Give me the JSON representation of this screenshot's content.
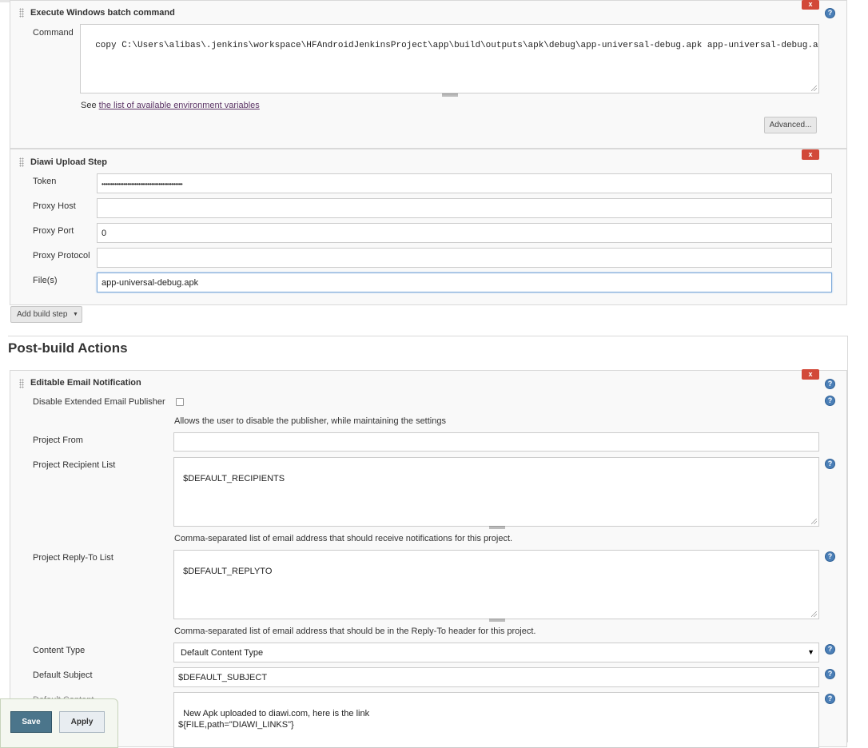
{
  "colors": {
    "delete": "#d24939",
    "help": "#4b7fb7",
    "save": "#4b758b"
  },
  "batch_step": {
    "title": "Execute Windows batch command",
    "delete_label": "x",
    "help_label": "?",
    "command_label": "Command",
    "command_value": "copy C:\\Users\\alibas\\.jenkins\\workspace\\HFAndroidJenkinsProject\\app\\build\\outputs\\apk\\debug\\app-universal-debug.apk app-universal-debug.apk",
    "see_prefix": "See",
    "env_link": "the list of available environment variables",
    "advanced_label": "Advanced..."
  },
  "diawi_step": {
    "title": "Diawi Upload Step",
    "delete_label": "x",
    "token_label": "Token",
    "token_value": "••••••••••••••••••••••••••••••••••••••••••••",
    "proxy_host_label": "Proxy Host",
    "proxy_host_value": "",
    "proxy_port_label": "Proxy Port",
    "proxy_port_value": "0",
    "proxy_protocol_label": "Proxy Protocol",
    "proxy_protocol_value": "",
    "files_label": "File(s)",
    "files_value": "app-universal-debug.apk"
  },
  "add_build_step_label": "Add build step",
  "post_build_heading": "Post-build Actions",
  "email_step": {
    "title": "Editable Email Notification",
    "delete_label": "x",
    "disable_label": "Disable Extended Email Publisher",
    "disable_desc": "Allows the user to disable the publisher, while maintaining the settings",
    "project_from_label": "Project From",
    "project_from_value": "",
    "recipient_label": "Project Recipient List",
    "recipient_value": "$DEFAULT_RECIPIENTS",
    "recipient_desc": "Comma-separated list of email address that should receive notifications for this project.",
    "replyto_label": "Project Reply-To List",
    "replyto_value": "$DEFAULT_REPLYTO",
    "replyto_desc": "Comma-separated list of email address that should be in the Reply-To header for this project.",
    "content_type_label": "Content Type",
    "content_type_value": "Default Content Type",
    "subject_label": "Default Subject",
    "subject_value": "$DEFAULT_SUBJECT",
    "content_label": "Default Content",
    "content_value": "New Apk uploaded to diawi.com, here is the link\n${FILE,path=\"DIAWI_LINKS\"}"
  },
  "save_label": "Save",
  "apply_label": "Apply"
}
